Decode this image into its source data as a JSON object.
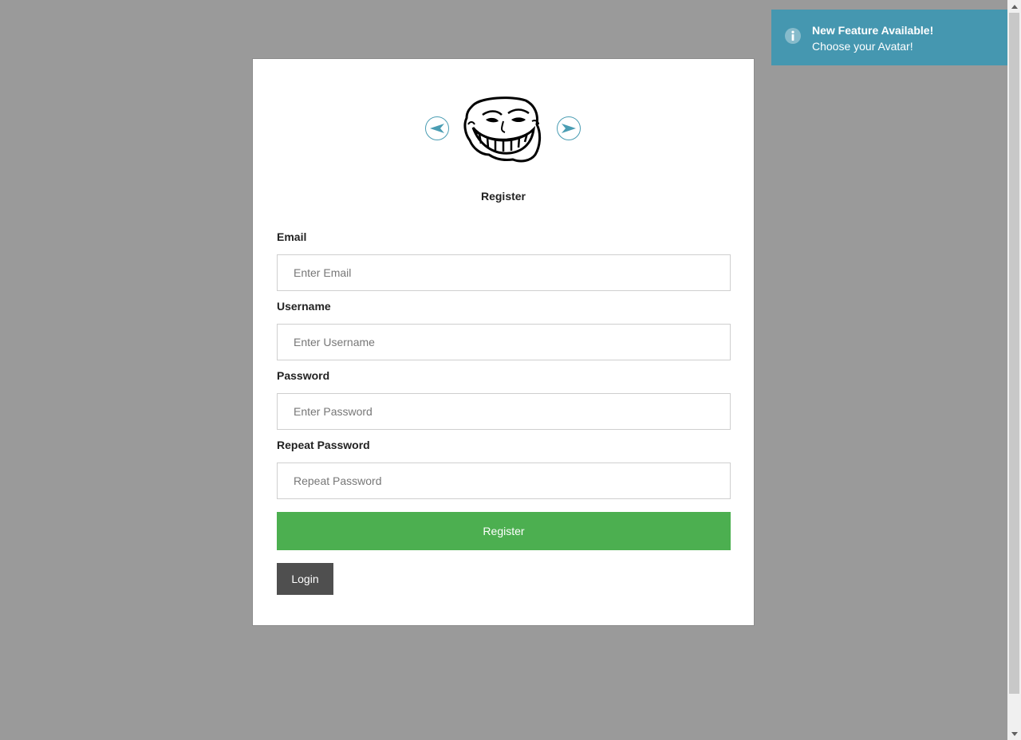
{
  "avatar": {
    "prev_icon": "arrow-left-icon",
    "next_icon": "arrow-right-icon",
    "image": "troll-face-avatar"
  },
  "form": {
    "heading": "Register",
    "email": {
      "label": "Email",
      "placeholder": "Enter Email",
      "value": ""
    },
    "username": {
      "label": "Username",
      "placeholder": "Enter Username",
      "value": ""
    },
    "password": {
      "label": "Password",
      "placeholder": "Enter Password",
      "value": ""
    },
    "repeat_password": {
      "label": "Repeat Password",
      "placeholder": "Repeat Password",
      "value": ""
    },
    "register_label": "Register",
    "login_label": "Login"
  },
  "toast": {
    "icon": "info-icon",
    "title": "New Feature Available!",
    "message": "Choose your Avatar!"
  },
  "colors": {
    "background": "#9a9a9a",
    "accent": "#4597b0",
    "register_button": "#4caf50",
    "login_button": "#4f4f4f"
  }
}
